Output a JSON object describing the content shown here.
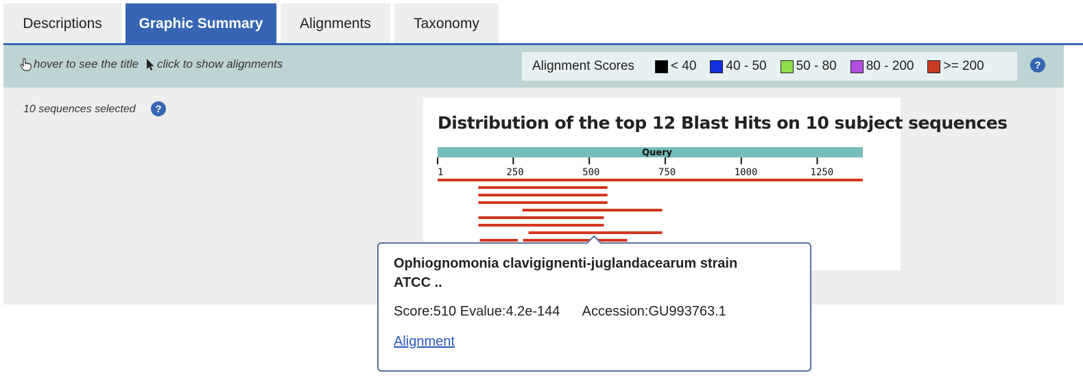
{
  "tabs": [
    {
      "label": "Descriptions",
      "active": false
    },
    {
      "label": "Graphic Summary",
      "active": true
    },
    {
      "label": "Alignments",
      "active": false
    },
    {
      "label": "Taxonomy",
      "active": false
    }
  ],
  "toolbar": {
    "hover_hint": "hover to see the title",
    "click_hint": "click to show alignments",
    "scores_title": "Alignment Scores",
    "legend": [
      {
        "label": "< 40",
        "color": "#000000"
      },
      {
        "label": "40 - 50",
        "color": "#1030e0"
      },
      {
        "label": "50 - 80",
        "color": "#8ede4c"
      },
      {
        "label": "80 - 200",
        "color": "#b24fe0"
      },
      {
        "label": ">= 200",
        "color": "#c83a22"
      }
    ],
    "help_glyph": "?"
  },
  "selection": {
    "text": "10 sequences selected",
    "help_glyph": "?"
  },
  "chart_data": {
    "type": "alignment-map",
    "title": "Distribution of the top 12 Blast Hits on 10 subject sequences",
    "query_label": "Query",
    "query_length": 1400,
    "tick_labels": [
      "1",
      "250",
      "500",
      "750",
      "1000",
      "1250"
    ],
    "tick_values": [
      1,
      250,
      500,
      750,
      1000,
      1250
    ],
    "hit_color": "#d2381e",
    "hits": [
      {
        "segments": [
          [
            1,
            1400
          ]
        ]
      },
      {
        "segments": [
          [
            135,
            560
          ]
        ]
      },
      {
        "segments": [
          [
            135,
            560
          ]
        ]
      },
      {
        "segments": [
          [
            135,
            560
          ]
        ]
      },
      {
        "segments": [
          [
            280,
            740
          ]
        ]
      },
      {
        "segments": [
          [
            135,
            548
          ]
        ]
      },
      {
        "segments": [
          [
            135,
            548
          ]
        ]
      },
      {
        "segments": [
          [
            300,
            740
          ]
        ]
      },
      {
        "segments": [
          [
            140,
            265
          ],
          [
            282,
            625
          ]
        ]
      }
    ]
  },
  "tooltip": {
    "title": "Ophiognomonia clavigignenti-juglandacearum strain ATCC ..",
    "score": "Score:510",
    "evalue": "Evalue:4.2e-144",
    "accession": "Accession:GU993763.1",
    "link": "Alignment"
  }
}
